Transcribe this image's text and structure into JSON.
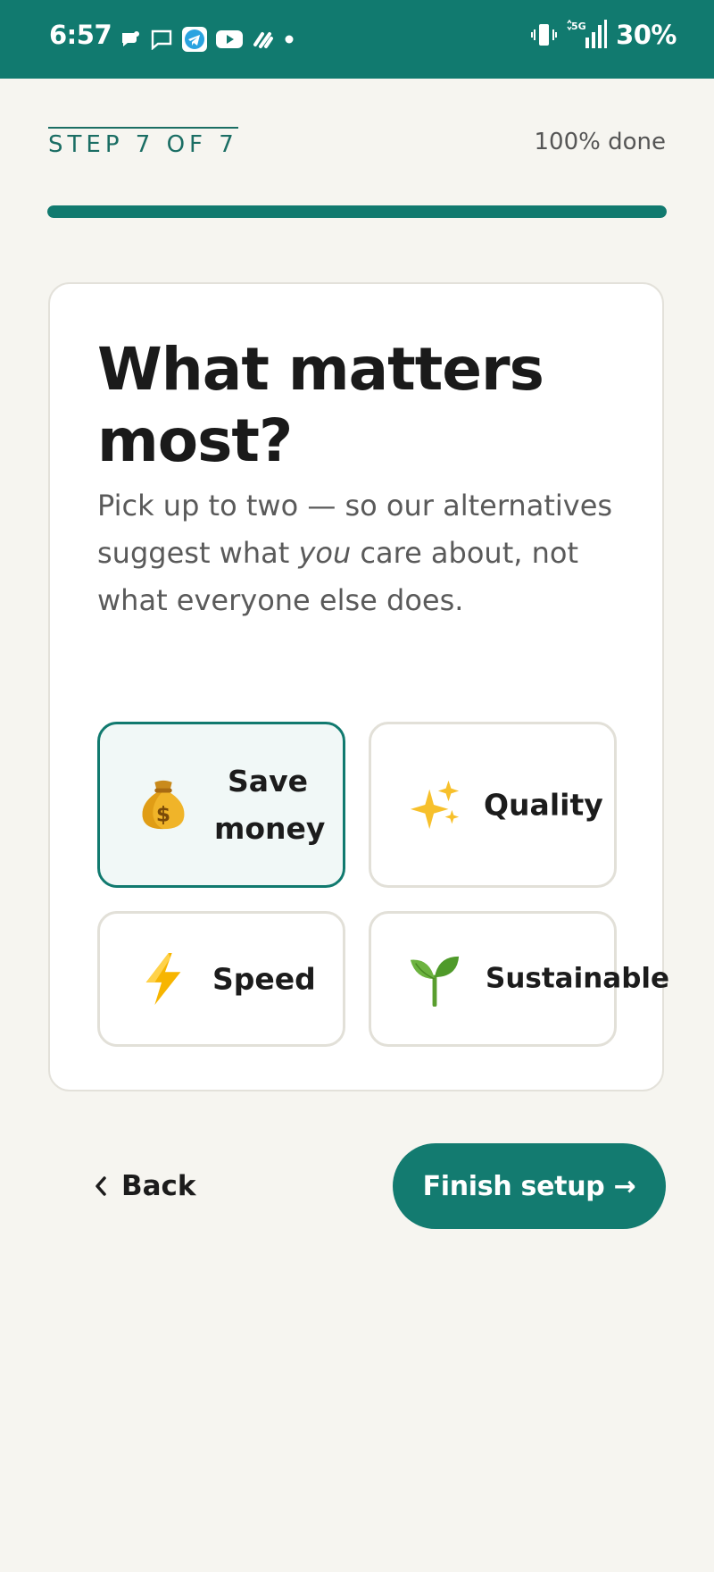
{
  "status_bar": {
    "time": "6:57",
    "battery": "30%",
    "network": "5G"
  },
  "header": {
    "step_label": "STEP 7 OF 7",
    "progress_text": "100% done",
    "progress_value": 1.0
  },
  "card": {
    "title": "What matters most?",
    "subtitle_before": "Pick up to two — so our alternatives suggest what ",
    "subtitle_emphasis": "you",
    "subtitle_after": " care about, not what everyone else does."
  },
  "options": [
    {
      "label": "Save money",
      "icon": "money-bag-icon",
      "selected": true
    },
    {
      "label": "Quality",
      "icon": "sparkles-icon",
      "selected": false
    },
    {
      "label": "Speed",
      "icon": "lightning-icon",
      "selected": false
    },
    {
      "label": "Sustainable",
      "icon": "seedling-icon",
      "selected": false
    }
  ],
  "footer": {
    "back_label": "Back",
    "finish_label": "Finish setup →"
  },
  "colors": {
    "accent": "#117a6f",
    "background": "#f6f5f0",
    "selected_bg": "#f1f8f7"
  }
}
